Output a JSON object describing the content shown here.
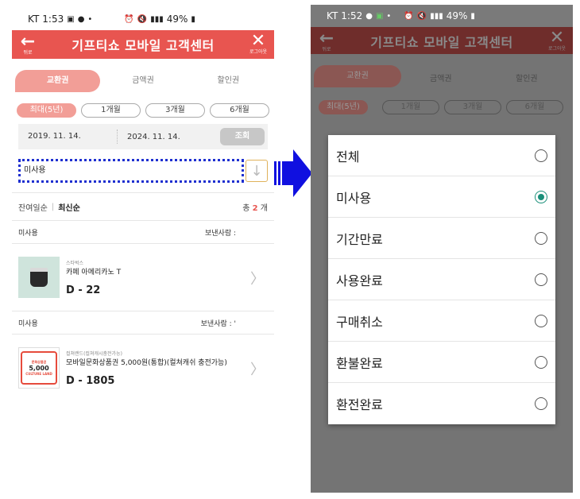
{
  "status": {
    "carrier": "KT",
    "time_left": "1:53",
    "time_right": "1:52",
    "battery": "49%"
  },
  "header": {
    "back_label": "뒤로",
    "title": "기프티쇼 모바일 고객센터",
    "logout_label": "로그아웃"
  },
  "tabs": [
    {
      "label": "교환권"
    },
    {
      "label": "금액권"
    },
    {
      "label": "할인권"
    }
  ],
  "periods": [
    {
      "label": "최대(5년)"
    },
    {
      "label": "1개월"
    },
    {
      "label": "3개월"
    },
    {
      "label": "6개월"
    }
  ],
  "dates": {
    "from": "2019. 11. 14.",
    "to": "2024. 11. 14.",
    "query_label": "조회"
  },
  "filter": {
    "selected": "미사용"
  },
  "sort": {
    "remaining": "잔여일순",
    "latest": "최신순",
    "total_prefix": "총",
    "total_count": "2",
    "total_suffix": "개"
  },
  "items": [
    {
      "status": "미사용",
      "sender_label": "보낸사람 :",
      "brand": "스타벅스",
      "name": "카페 아메리카노 T",
      "dday": "D - 22"
    },
    {
      "status": "미사용",
      "sender_label": "보낸사람 : '",
      "brand": "컬쳐랜드(컬쳐캐시충전가능)",
      "name": "모바일문화상품권 5,000원(통합)(컬쳐캐쉬 충전가능)",
      "dday": "D - 1805",
      "card_value": "5,000",
      "card_top": "문화상품권",
      "card_bottom": "CULTURE LAND"
    }
  ],
  "dialog": {
    "options": [
      {
        "label": "전체",
        "selected": false
      },
      {
        "label": "미사용",
        "selected": true
      },
      {
        "label": "기간만료",
        "selected": false
      },
      {
        "label": "사용완료",
        "selected": false
      },
      {
        "label": "구매취소",
        "selected": false
      },
      {
        "label": "환불완료",
        "selected": false
      },
      {
        "label": "환전완료",
        "selected": false
      }
    ]
  },
  "colors": {
    "brand_red": "#e85550",
    "tab_active": "#f29e97",
    "focus_blue": "#1e2fd0",
    "radio_on": "#1a8f7a",
    "arrow_blue": "#1010e0"
  }
}
